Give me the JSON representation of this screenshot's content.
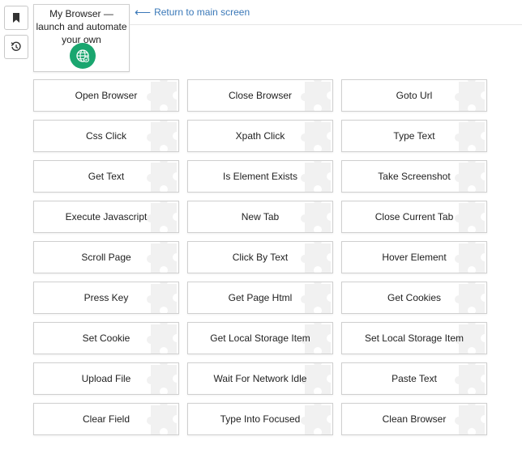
{
  "toolbar": {
    "bookmark_icon": "bookmark-icon",
    "history_icon": "history-icon"
  },
  "app": {
    "title": "My Browser — launch and automate your own",
    "icon": "globe-icon",
    "icon_color": "#1aa66f"
  },
  "nav": {
    "back_label": "Return to main screen",
    "link_color": "#3a78b8"
  },
  "actions": [
    "Open Browser",
    "Close Browser",
    "Goto Url",
    "Css Click",
    "Xpath Click",
    "Type Text",
    "Get Text",
    "Is Element Exists",
    "Take Screenshot",
    "Execute Javascript",
    "New Tab",
    "Close Current Tab",
    "Scroll Page",
    "Click By Text",
    "Hover Element",
    "Press Key",
    "Get Page Html",
    "Get Cookies",
    "Set Cookie",
    "Get Local Storage Item",
    "Set Local Storage Item",
    "Upload File",
    "Wait For Network Idle",
    "Paste Text",
    "Clear Field",
    "Type Into Focused",
    "Clean Browser"
  ]
}
